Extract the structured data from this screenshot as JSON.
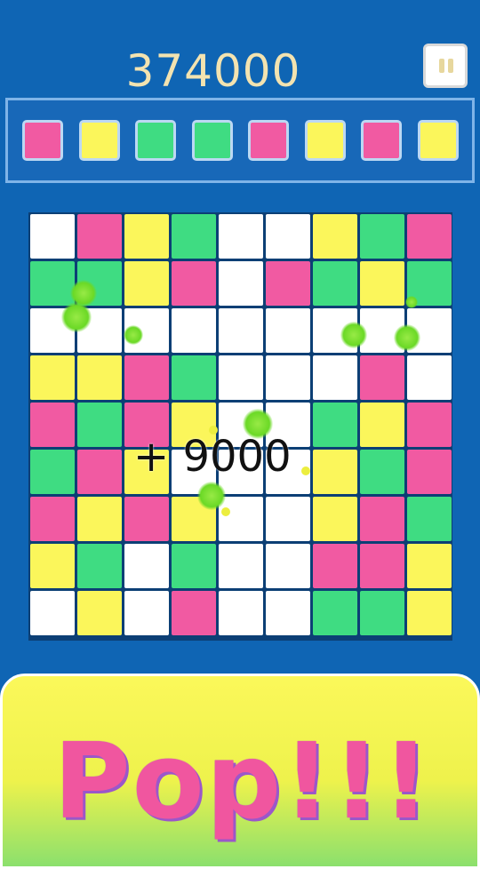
{
  "score": "374000",
  "pause_label": "Pause",
  "colors": {
    "pink": "#f15aa2",
    "yellow": "#fbf65b",
    "green": "#3fdc82",
    "white": "#ffffff"
  },
  "queue": [
    "pink",
    "yellow",
    "green",
    "green",
    "pink",
    "yellow",
    "pink",
    "yellow"
  ],
  "board": [
    [
      "white",
      "pink",
      "yellow",
      "green",
      "white",
      "white",
      "yellow",
      "green",
      "pink"
    ],
    [
      "green",
      "green",
      "yellow",
      "pink",
      "white",
      "pink",
      "green",
      "yellow",
      "green"
    ],
    [
      "white",
      "white",
      "white",
      "white",
      "white",
      "white",
      "white",
      "white",
      "white"
    ],
    [
      "yellow",
      "yellow",
      "pink",
      "green",
      "white",
      "white",
      "white",
      "pink",
      "white"
    ],
    [
      "pink",
      "green",
      "pink",
      "yellow",
      "white",
      "white",
      "green",
      "yellow",
      "pink"
    ],
    [
      "green",
      "pink",
      "yellow",
      "white",
      "white",
      "white",
      "yellow",
      "green",
      "pink"
    ],
    [
      "pink",
      "yellow",
      "pink",
      "yellow",
      "white",
      "white",
      "yellow",
      "pink",
      "green"
    ],
    [
      "yellow",
      "green",
      "white",
      "green",
      "white",
      "white",
      "pink",
      "pink",
      "yellow"
    ],
    [
      "white",
      "yellow",
      "white",
      "pink",
      "white",
      "white",
      "green",
      "green",
      "yellow"
    ]
  ],
  "score_popup": "+ 9000",
  "banner_text": "Pop!!!"
}
